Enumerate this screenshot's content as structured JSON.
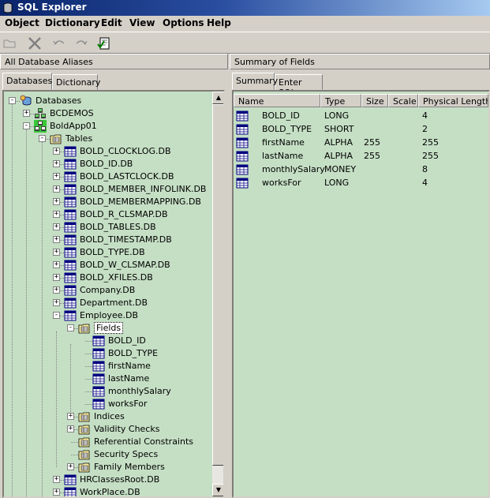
{
  "window": {
    "title": "SQL Explorer"
  },
  "menu": [
    "Object",
    "Dictionary",
    "Edit",
    "View",
    "Options",
    "Help"
  ],
  "left_header": "All Database Aliases",
  "right_header": "Summary of Fields",
  "left_tabs": [
    "Databases",
    "Dictionary"
  ],
  "right_tabs": [
    "Summary",
    "Enter SQL"
  ],
  "tree": {
    "root": "Databases",
    "aliases": [
      "BCDEMOS",
      "BoldApp01"
    ],
    "tables_node": "Tables",
    "tables": [
      "BOLD_CLOCKLOG.DB",
      "BOLD_ID.DB",
      "BOLD_LASTCLOCK.DB",
      "BOLD_MEMBER_INFOLINK.DB",
      "BOLD_MEMBERMAPPING.DB",
      "BOLD_R_CLSMAP.DB",
      "BOLD_TABLES.DB",
      "BOLD_TIMESTAMP.DB",
      "BOLD_TYPE.DB",
      "BOLD_W_CLSMAP.DB",
      "BOLD_XFILES.DB",
      "Company.DB",
      "Department.DB",
      "Employee.DB"
    ],
    "fields_node": "Fields",
    "fields": [
      "BOLD_ID",
      "BOLD_TYPE",
      "firstName",
      "lastName",
      "monthlySalary",
      "worksFor"
    ],
    "employee_children": [
      "Indices",
      "Validity Checks",
      "Referential Constraints",
      "Security Specs",
      "Family Members"
    ],
    "after_tables": [
      "HRClassesRoot.DB",
      "WorkPlace.DB"
    ]
  },
  "grid": {
    "columns": [
      "Name",
      "Type",
      "Size",
      "Scale",
      "Physical Length"
    ],
    "rows": [
      {
        "name": "BOLD_ID",
        "type": "LONG",
        "size": "",
        "scale": "",
        "physical_length": "4"
      },
      {
        "name": "BOLD_TYPE",
        "type": "SHORT",
        "size": "",
        "scale": "",
        "physical_length": "2"
      },
      {
        "name": "firstName",
        "type": "ALPHA",
        "size": "255",
        "scale": "",
        "physical_length": "255"
      },
      {
        "name": "lastName",
        "type": "ALPHA",
        "size": "255",
        "scale": "",
        "physical_length": "255"
      },
      {
        "name": "monthlySalary",
        "type": "MONEY",
        "size": "",
        "scale": "",
        "physical_length": "8"
      },
      {
        "name": "worksFor",
        "type": "LONG",
        "size": "",
        "scale": "",
        "physical_length": "4"
      }
    ]
  },
  "colors": {
    "panel_bg": "#c5dfc5",
    "chrome": "#d4d0c8",
    "titlebar": "#0a246a"
  }
}
